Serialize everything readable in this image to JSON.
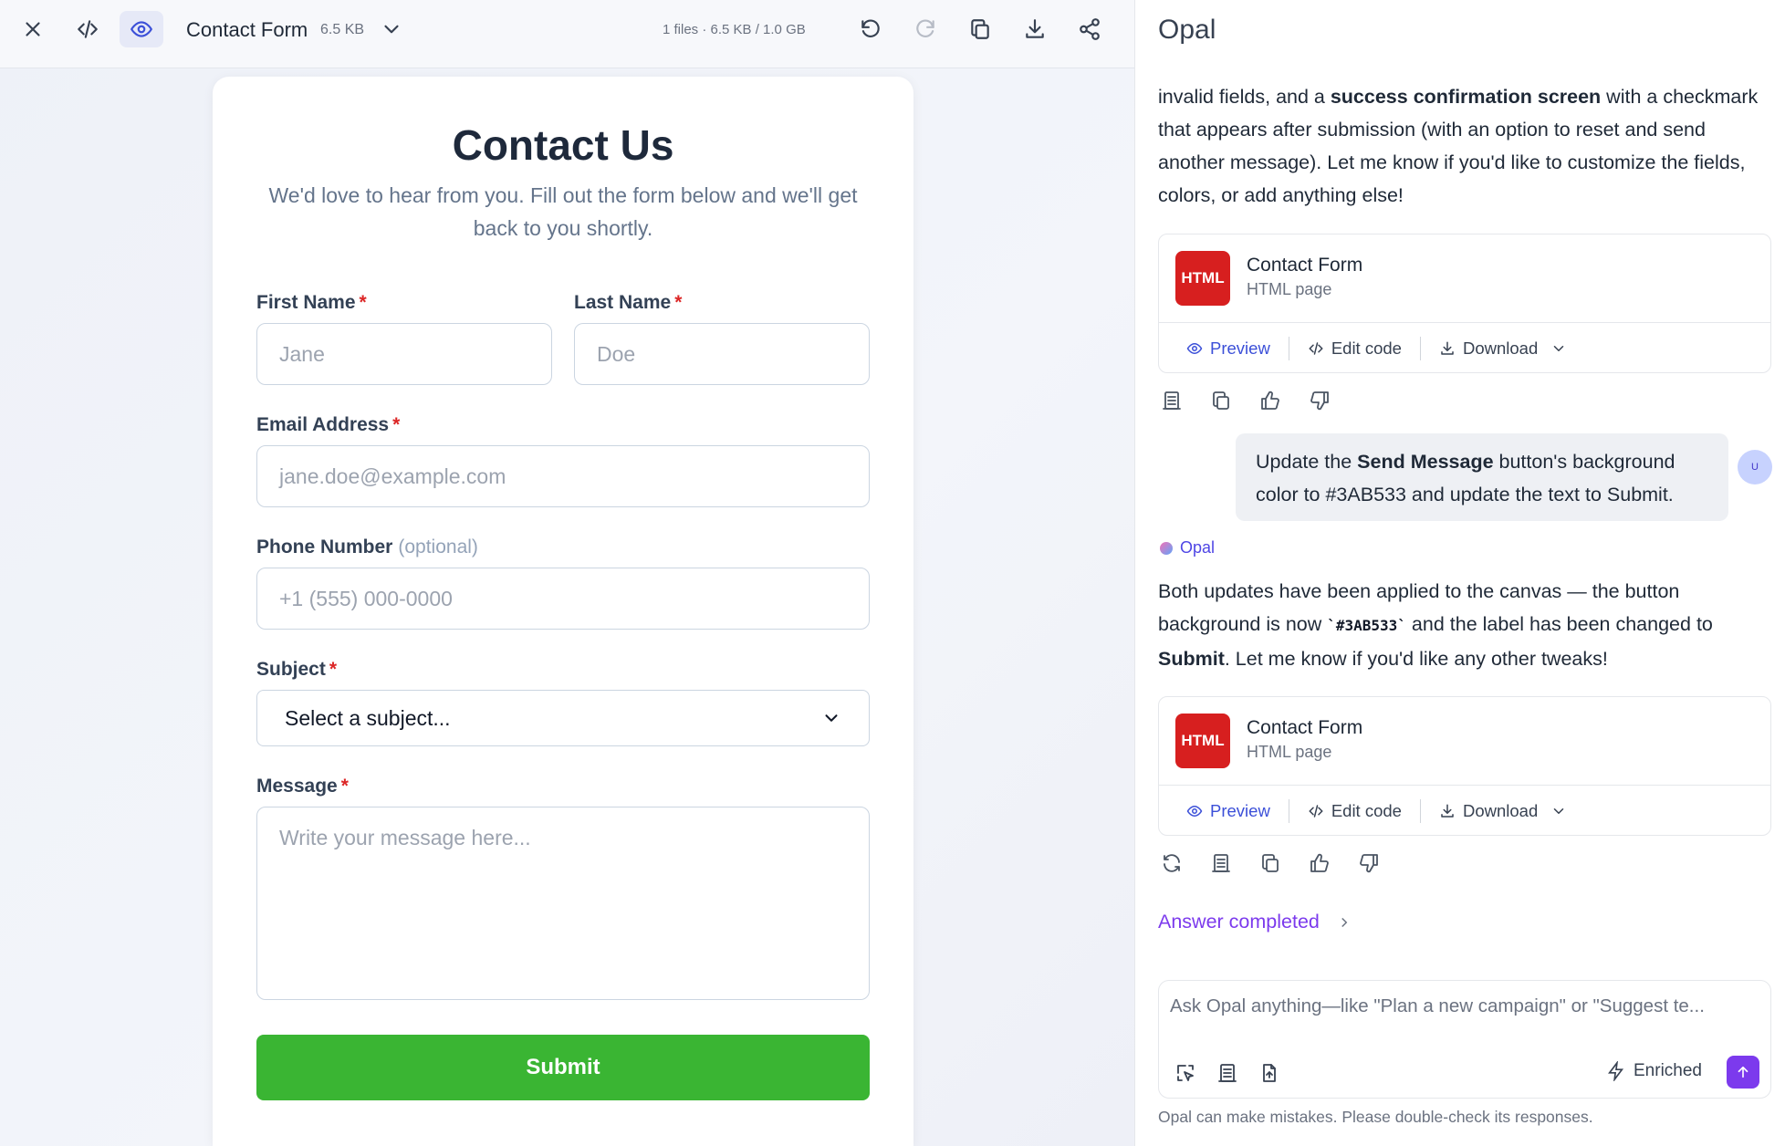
{
  "toolbar": {
    "doc_title": "Contact Form",
    "doc_size": "6.5 KB",
    "files_info": "1 files · 6.5 KB / 1.0 GB"
  },
  "form": {
    "title": "Contact Us",
    "subtitle": "We'd love to hear from you. Fill out the form below and we'll get back to you shortly.",
    "first_name_label": "First Name",
    "first_name_placeholder": "Jane",
    "last_name_label": "Last Name",
    "last_name_placeholder": "Doe",
    "email_label": "Email Address",
    "email_placeholder": "jane.doe@example.com",
    "phone_label": "Phone Number",
    "phone_optional": "(optional)",
    "phone_placeholder": "+1 (555) 000-0000",
    "subject_label": "Subject",
    "subject_value": "Select a subject...",
    "message_label": "Message",
    "message_placeholder": "Write your message here...",
    "required_mark": "*",
    "submit_label": "Submit",
    "submit_color": "#3AB533"
  },
  "chat": {
    "title": "Opal",
    "msg1_part1": "invalid fields, and a ",
    "msg1_bold": "success confirmation screen",
    "msg1_part2": " with a checkmark that appears after submission (with an option to reset and send another message). Let me know if you'd like to customize the fields, colors, or add anything else!",
    "artifact_name": "Contact Form",
    "artifact_type": "HTML page",
    "artifact_badge": "HTML",
    "preview_label": "Preview",
    "edit_label": "Edit code",
    "download_label": "Download",
    "user_part1": "Update the ",
    "user_bold": "Send Message",
    "user_part2": " button's background color to #3AB533 and update the text to Submit.",
    "avatar_text": "U",
    "assistant_name": "Opal",
    "msg2_part1": "Both updates have been applied to the canvas — the button background is now ",
    "msg2_code": "`#3AB533`",
    "msg2_part2": " and the label has been changed to ",
    "msg2_bold": "Submit",
    "msg2_part3": ". Let me know if you'd like any other tweaks!",
    "answer_status": "Answer completed",
    "composer_placeholder": "Ask Opal anything—like \"Plan a new campaign\" or \"Suggest te...",
    "enriched_label": "Enriched",
    "disclaimer": "Opal can make mistakes. Please double-check its responses."
  }
}
